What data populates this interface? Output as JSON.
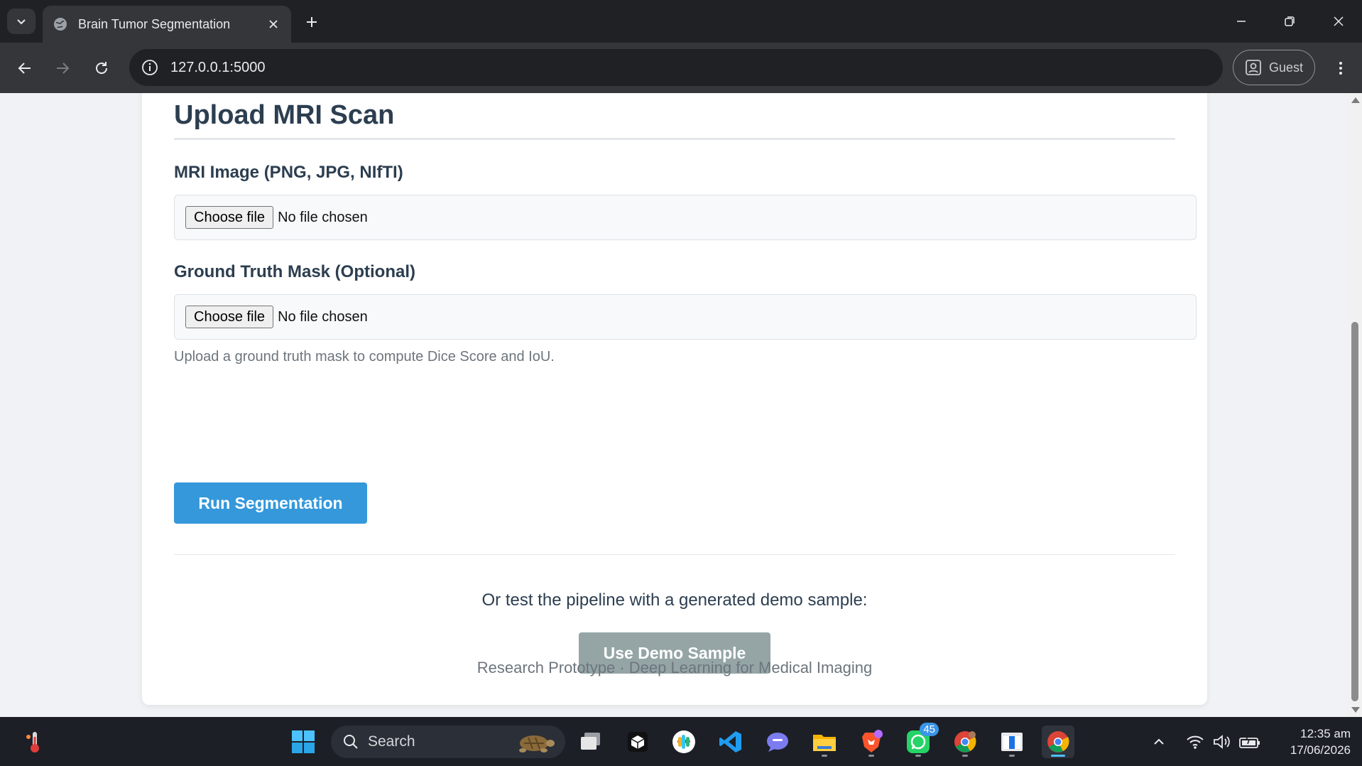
{
  "browser": {
    "tab_title": "Brain Tumor Segmentation",
    "url": "127.0.0.1:5000",
    "profile_label": "Guest"
  },
  "page": {
    "section_title": "Upload MRI Scan",
    "mri_field": {
      "label": "MRI Image (PNG, JPG, NIfTI)",
      "button_label": "Choose file",
      "status": "No file chosen"
    },
    "mask_field": {
      "label": "Ground Truth Mask (Optional)",
      "button_label": "Choose file",
      "status": "No file chosen",
      "hint": "Upload a ground truth mask to compute Dice Score and IoU."
    },
    "run_button": "Run Segmentation",
    "demo_prompt": "Or test the pipeline with a generated demo sample:",
    "demo_button": "Use Demo Sample",
    "footer": "Research Prototype · Deep Learning for Medical Imaging"
  },
  "taskbar": {
    "search_label": "Search",
    "whatsapp_badge": "45",
    "time": "12:35 am",
    "date": "17/06/2026"
  },
  "colors": {
    "primary_button": "#3498db",
    "secondary_button": "#95a5a6",
    "heading_text": "#2c3e50"
  }
}
